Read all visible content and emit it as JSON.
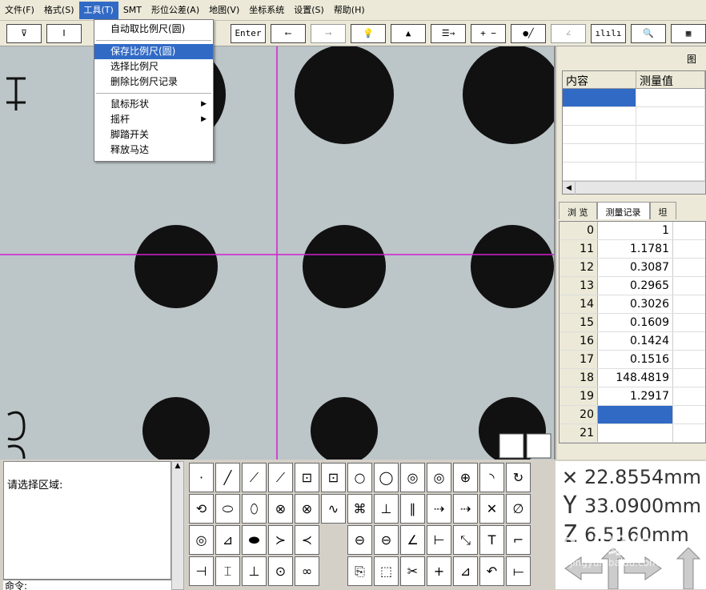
{
  "menubar": {
    "items": [
      "文件(F)",
      "格式(S)",
      "工具(T)",
      "SMT",
      "形位公差(A)",
      "地图(V)",
      "坐标系统",
      "设置(S)",
      "帮助(H)"
    ],
    "active_index": 2
  },
  "toolbar": {
    "enter_label": "Enter",
    "plus_minus_label": "+ −"
  },
  "dropdown": {
    "items": [
      {
        "label": "自动取比例尺(圆)",
        "highlight": false,
        "submenu": false
      },
      {
        "sep": true
      },
      {
        "label": "保存比例尺(圆)",
        "highlight": true,
        "submenu": false
      },
      {
        "label": "选择比例尺",
        "highlight": false,
        "submenu": false
      },
      {
        "label": "删除比例尺记录",
        "highlight": false,
        "submenu": false
      },
      {
        "sep": true
      },
      {
        "label": "鼠标形状",
        "highlight": false,
        "submenu": true
      },
      {
        "label": "摇杆",
        "highlight": false,
        "submenu": true
      },
      {
        "label": "脚踏开关",
        "highlight": false,
        "submenu": false
      },
      {
        "label": "释放马达",
        "highlight": false,
        "submenu": false
      }
    ]
  },
  "viewer": {
    "crosshair_color": "#d020d0",
    "dot_color": "#111111",
    "background_color": "#bcc5c8"
  },
  "right_panel": {
    "title": "图",
    "table_headers": [
      "内容",
      "测量值"
    ],
    "tabs": [
      "浏 览",
      "测量记录",
      "坦"
    ],
    "active_tab": 1,
    "records": [
      {
        "idx": "0",
        "val": "1"
      },
      {
        "idx": "11",
        "val": "1.1781"
      },
      {
        "idx": "12",
        "val": "0.3087"
      },
      {
        "idx": "13",
        "val": "0.2965"
      },
      {
        "idx": "14",
        "val": "0.3026"
      },
      {
        "idx": "15",
        "val": "0.1609"
      },
      {
        "idx": "16",
        "val": "0.1424"
      },
      {
        "idx": "17",
        "val": "0.1516"
      },
      {
        "idx": "18",
        "val": "148.4819"
      },
      {
        "idx": "19",
        "val": "1.2917"
      },
      {
        "idx": "20",
        "val": ""
      },
      {
        "idx": "21",
        "val": ""
      }
    ]
  },
  "bottom": {
    "message": "请选择区域:",
    "command_label": "命令:",
    "coords": [
      {
        "axis": "X",
        "value": "22.8554mm"
      },
      {
        "axis": "Y",
        "value": "33.0900mm"
      },
      {
        "axis": "Z",
        "value": "6.5160mm"
      }
    ]
  },
  "watermark": {
    "text": "Bai 经验",
    "sub": "jingyan.baidu.com"
  },
  "accent_color": "#316ac5"
}
